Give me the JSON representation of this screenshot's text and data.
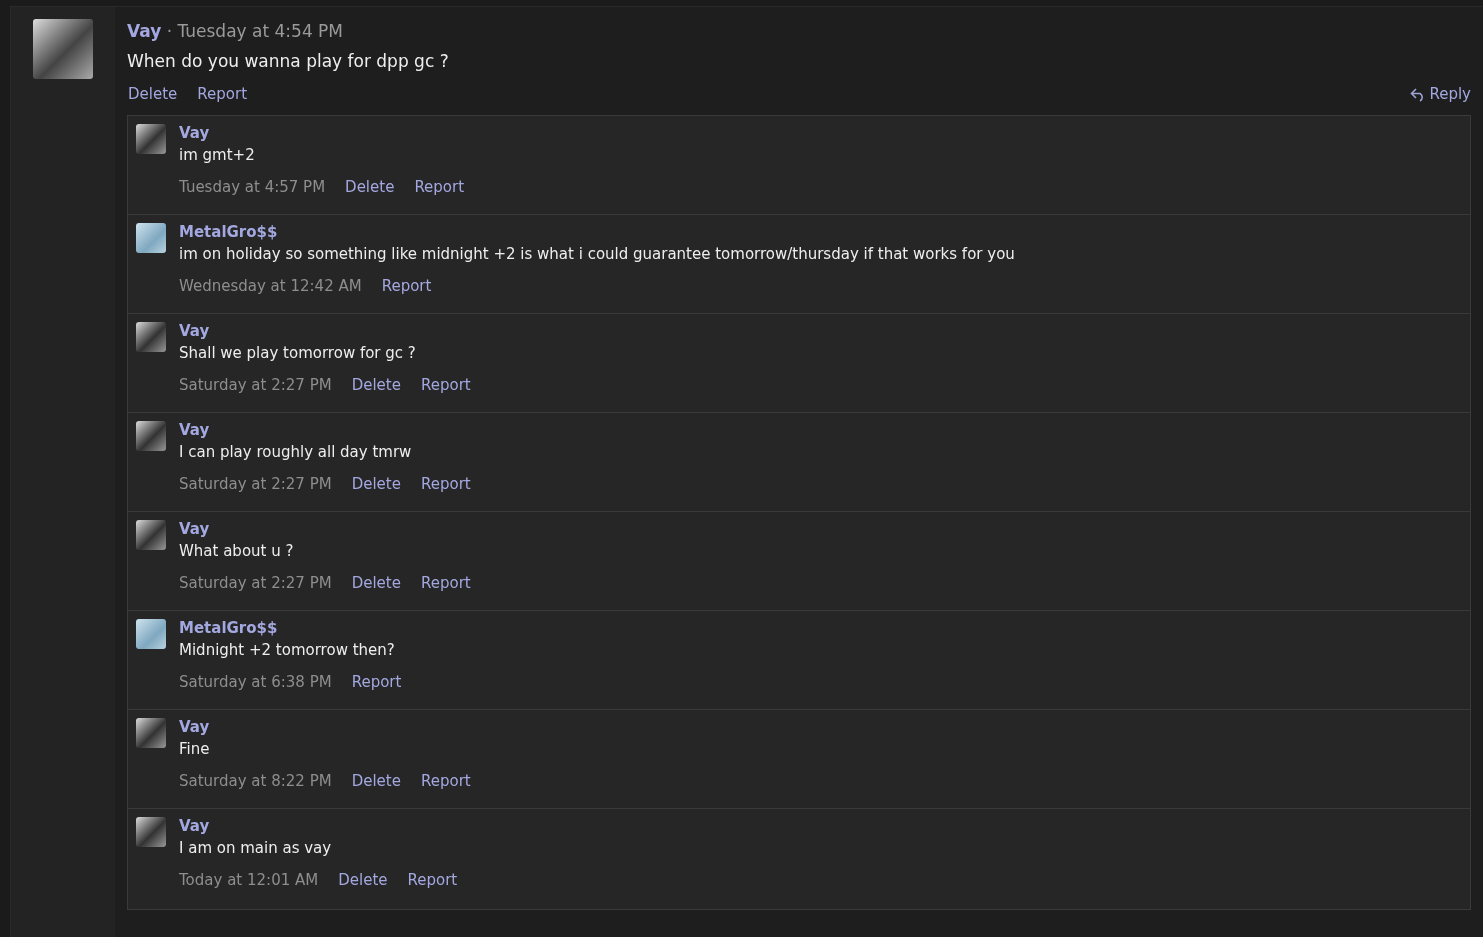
{
  "post": {
    "author": "Vay",
    "separator": "·",
    "time": "Tuesday at 4:54 PM",
    "text": "When do you wanna play for dpp gc ?",
    "actions": [
      "Delete",
      "Report"
    ],
    "reply": "Reply"
  },
  "comments": [
    {
      "author": "Vay",
      "kind": "gray",
      "text": "im gmt+2",
      "time": "Tuesday at 4:57 PM",
      "actions": [
        "Delete",
        "Report"
      ]
    },
    {
      "author": "MetalGro$$",
      "kind": "blue",
      "text": "im on holiday so something like midnight +2 is what i could guarantee tomorrow/thursday if that works for you",
      "time": "Wednesday at 12:42 AM",
      "actions": [
        "Report"
      ]
    },
    {
      "author": "Vay",
      "kind": "gray",
      "text": "Shall we play tomorrow for gc ?",
      "time": "Saturday at 2:27 PM",
      "actions": [
        "Delete",
        "Report"
      ]
    },
    {
      "author": "Vay",
      "kind": "gray",
      "text": "I can play roughly all day tmrw",
      "time": "Saturday at 2:27 PM",
      "actions": [
        "Delete",
        "Report"
      ]
    },
    {
      "author": "Vay",
      "kind": "gray",
      "text": "What about u ?",
      "time": "Saturday at 2:27 PM",
      "actions": [
        "Delete",
        "Report"
      ]
    },
    {
      "author": "MetalGro$$",
      "kind": "blue",
      "text": "Midnight +2 tomorrow then?",
      "time": "Saturday at 6:38 PM",
      "actions": [
        "Report"
      ]
    },
    {
      "author": "Vay",
      "kind": "gray",
      "text": "Fine",
      "time": "Saturday at 8:22 PM",
      "actions": [
        "Delete",
        "Report"
      ]
    },
    {
      "author": "Vay",
      "kind": "gray",
      "text": "I am on main as vay",
      "time": "Today at 12:01 AM",
      "actions": [
        "Delete",
        "Report"
      ]
    }
  ]
}
